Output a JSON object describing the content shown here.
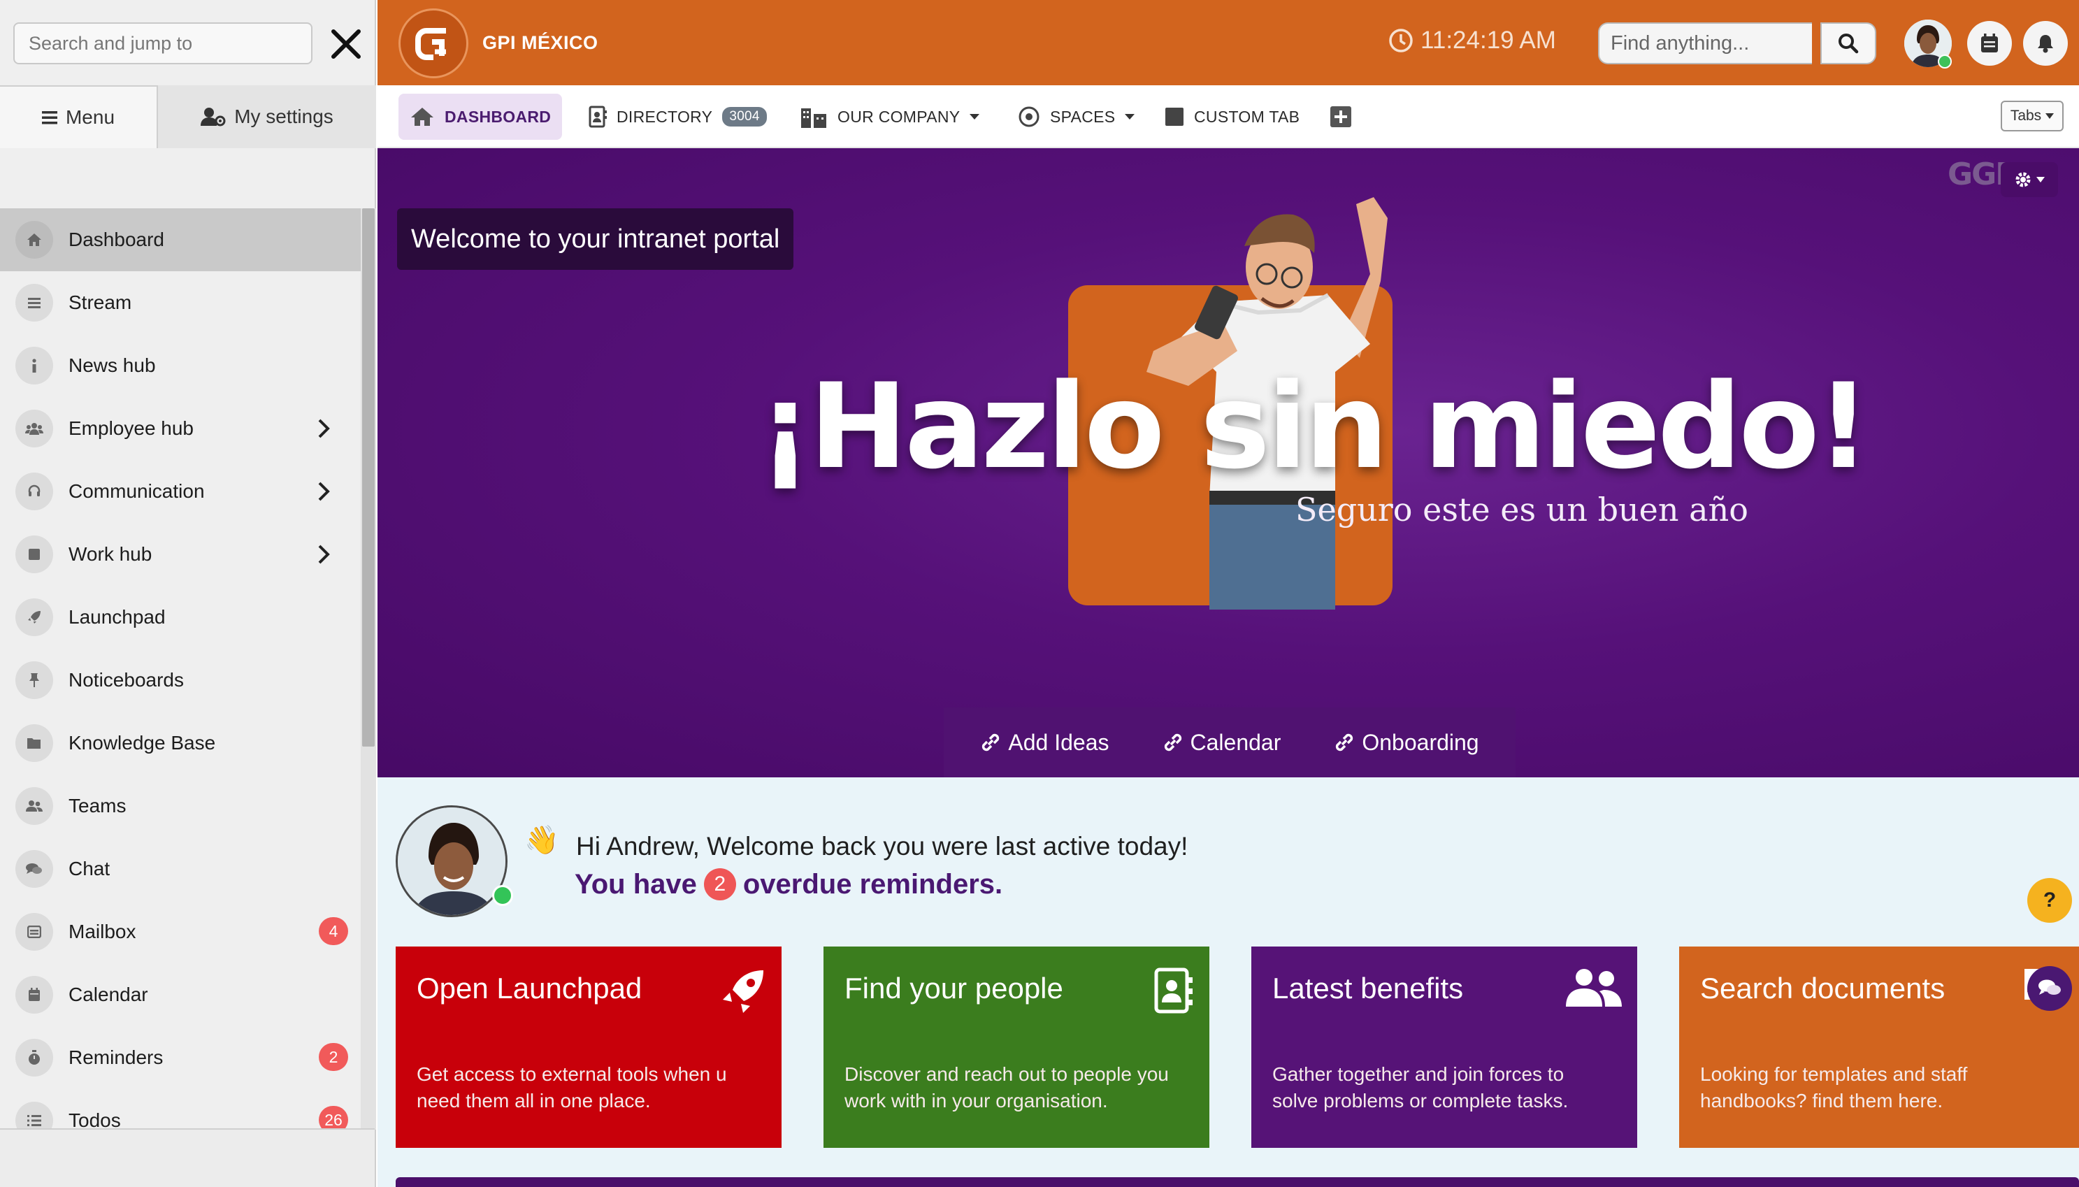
{
  "sidebar": {
    "search_placeholder": "Search and jump to",
    "tab_menu": "Menu",
    "tab_settings": "My settings",
    "items": [
      {
        "label": "Dashboard",
        "icon": "home-icon",
        "active": true
      },
      {
        "label": "Stream",
        "icon": "lines-icon"
      },
      {
        "label": "News hub",
        "icon": "info-icon"
      },
      {
        "label": "Employee hub",
        "icon": "users-icon",
        "submenu": true
      },
      {
        "label": "Communication",
        "icon": "headset-icon",
        "submenu": true
      },
      {
        "label": "Work hub",
        "icon": "square-icon",
        "submenu": true
      },
      {
        "label": "Launchpad",
        "icon": "rocket-icon"
      },
      {
        "label": "Noticeboards",
        "icon": "pin-icon"
      },
      {
        "label": "Knowledge Base",
        "icon": "folder-icon"
      },
      {
        "label": "Teams",
        "icon": "team-icon"
      },
      {
        "label": "Chat",
        "icon": "chat-icon"
      },
      {
        "label": "Mailbox",
        "icon": "mailbox-icon",
        "badge": "4"
      },
      {
        "label": "Calendar",
        "icon": "calendar-icon"
      },
      {
        "label": "Reminders",
        "icon": "stopwatch-icon",
        "badge": "2"
      },
      {
        "label": "Todos",
        "icon": "list-icon",
        "badge": "26"
      }
    ]
  },
  "header": {
    "brand": "GPI MÉXICO",
    "time": "11:24:19 AM",
    "find_placeholder": "Find anything..."
  },
  "tabs": {
    "dashboard": "DASHBOARD",
    "directory": "DIRECTORY",
    "directory_count": "3004",
    "company": "OUR COMPANY",
    "spaces": "SPACES",
    "custom": "CUSTOM TAB",
    "selector": "Tabs"
  },
  "hero": {
    "welcome": "Welcome to your intranet portal",
    "headline": "¡Hazlo sin miedo!",
    "subline": "Seguro este es un buen año",
    "links": [
      "Add Ideas",
      "Calendar",
      "Onboarding"
    ]
  },
  "greeting": {
    "line1": "Hi Andrew, Welcome back you were last active today!",
    "line2_pre": "You have",
    "count": "2",
    "line2_post": "overdue reminders."
  },
  "cards": [
    {
      "title": "Open Launchpad",
      "desc": "Get access to external tools when u need them all in one place.",
      "color": "#c8000a",
      "icon": "rocket-icon"
    },
    {
      "title": "Find your people",
      "desc": "Discover and reach out to people you work with in your organisation.",
      "color": "#3b7d1e",
      "icon": "contact-book-icon"
    },
    {
      "title": "Latest benefits",
      "desc": "Gather together and join forces to solve problems or complete tasks.",
      "color": "#561377",
      "icon": "users-icon"
    },
    {
      "title": "Search documents",
      "desc": "Looking for templates and staff handbooks? find them here.",
      "color": "#d2641e",
      "icon": "document-icon"
    }
  ],
  "colors": {
    "brand_orange": "#d2641e",
    "brand_purple": "#4f0f70",
    "badge_red": "#f15a5a"
  }
}
